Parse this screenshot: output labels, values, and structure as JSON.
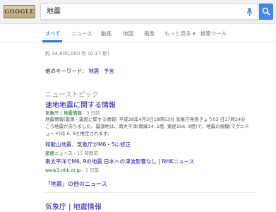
{
  "logo": {
    "text": "GOOGLE"
  },
  "search": {
    "query": "地震"
  },
  "tabs": [
    {
      "label": "すべて"
    },
    {
      "label": "ニュース"
    },
    {
      "label": "動画"
    },
    {
      "label": "地図"
    },
    {
      "label": "画像"
    },
    {
      "label": "もっと見る ▾"
    },
    {
      "label": "検索ツール"
    }
  ],
  "stats": "約 34,600,000 件 (0.37 秒)",
  "related": {
    "label": "他のキーワード:",
    "items": [
      "地震",
      "予言"
    ]
  },
  "news": {
    "heading": "ニューストピック",
    "items": [
      {
        "title": "速地地震に関する情報",
        "source": "気象庁 | 地震情報",
        "date": " - 3 日前",
        "snippet": "地震情報(震源・震度に関する情報) 平成28年4月3日18時53分 気象庁発表きょう03 日17時24分ころ地震がありました。震源地は、南大平洋(南緯14, 2度, 東経166, 8度)で、地震の規模(マグニチュード)は 6, 9と推定されます。"
      },
      {
        "title": "和歌山地震、気象庁がM6・5に修正",
        "source": "産経ニュース",
        "date": " - 15 時間前"
      },
      {
        "title": "南太平洋でM6, 9の地震 日本への津波影響なし | NHKニュース",
        "source": "www3.nhk.or.jp",
        "date": " - 3 日前"
      }
    ],
    "more": "「地震」の他のニュース"
  },
  "result": {
    "title": "気象庁 | 地震情報"
  }
}
